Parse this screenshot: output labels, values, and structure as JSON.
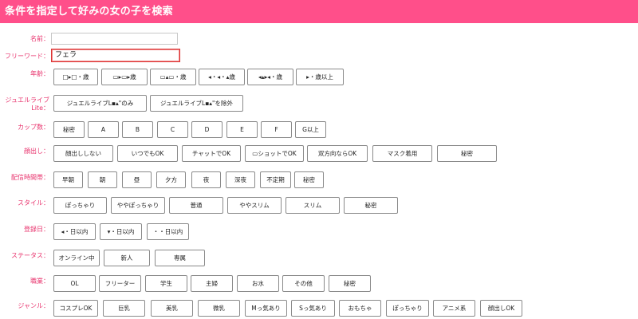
{
  "header": {
    "title": "条件を指定して好みの女の子を検索"
  },
  "labels": {
    "name": "名前：",
    "freeword": "フリーワード：",
    "age": "年齢：",
    "jewel": "ジュエルライブLite：",
    "cup": "カップ数：",
    "face": "顔出し：",
    "time": "配信時間帯：",
    "style": "スタイル：",
    "register": "登録日：",
    "status": "ステータス：",
    "job": "職業：",
    "genre": "ジャンル："
  },
  "inputs": {
    "name_value": "",
    "freeword_value": "フェラ"
  },
  "age": [
    "□▸□・歳",
    "▭▸▭▸歳",
    "▭▴▭・歳",
    "◂・◂・▴歳",
    "◂▴▸◂・歳",
    "▸・歳以上"
  ],
  "jewel": [
    "ジュエルライブL▪▴\"のみ",
    "ジュエルライブL▪▴\"を除外"
  ],
  "cup": [
    "秘密",
    "A",
    "B",
    "C",
    "D",
    "E",
    "F",
    "G以上"
  ],
  "face": [
    "顔出ししない",
    "いつでもOK",
    "チャットでOK",
    "▭ショットでOK",
    "双方向ならOK",
    "マスク着用",
    "秘密"
  ],
  "time": [
    "早朝",
    "朝",
    "昼",
    "夕方",
    "夜",
    "深夜",
    "不定期",
    "秘密"
  ],
  "style": [
    "ぽっちゃり",
    "ややぽっちゃり",
    "普通",
    "ややスリム",
    "スリム",
    "秘密"
  ],
  "register": [
    "◂・日以内",
    "▾・日以内",
    "・・日以内"
  ],
  "status": [
    "オンライン中",
    "新人",
    "専属"
  ],
  "job": [
    "OL",
    "フリーター",
    "学生",
    "主婦",
    "お水",
    "その他",
    "秘密"
  ],
  "genre": [
    "コスプレOK",
    "巨乳",
    "美乳",
    "微乳",
    "Mっ気あり",
    "Sっ気あり",
    "おもちゃ",
    "ぽっちゃり",
    "アニメ系",
    "顔出しOK"
  ],
  "colors": {
    "header_bg": "#ff4f8a",
    "label": "#e8336d",
    "focus_border": "#dd3333"
  }
}
